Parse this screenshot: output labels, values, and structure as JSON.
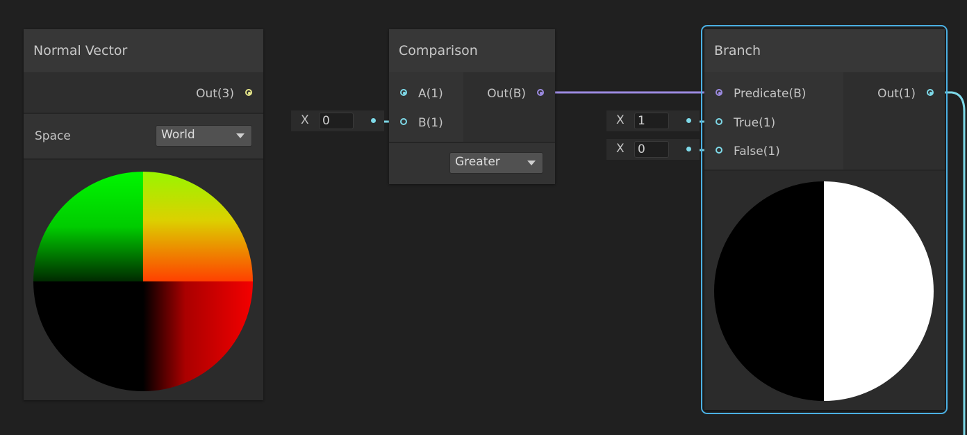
{
  "nodes": {
    "normal_vector": {
      "title": "Normal Vector",
      "output_label": "Out(3)",
      "space_label": "Space",
      "space_value": "World"
    },
    "comparison": {
      "title": "Comparison",
      "input_a_label": "A(1)",
      "input_b_label": "B(1)",
      "output_label": "Out(B)",
      "operation_value": "Greater",
      "b_inline": {
        "axis": "X",
        "value": "0"
      }
    },
    "branch": {
      "title": "Branch",
      "predicate_label": "Predicate(B)",
      "true_label": "True(1)",
      "false_label": "False(1)",
      "output_label": "Out(1)",
      "true_inline": {
        "axis": "X",
        "value": "1"
      },
      "false_inline": {
        "axis": "X",
        "value": "0"
      }
    }
  },
  "colors": {
    "canvas_bg": "#202020",
    "selection_outline": "#4bb0e3",
    "vector3_port": "#e6e68a",
    "vector1_port": "#7ed9e8",
    "boolean_port": "#9b8ae0"
  }
}
